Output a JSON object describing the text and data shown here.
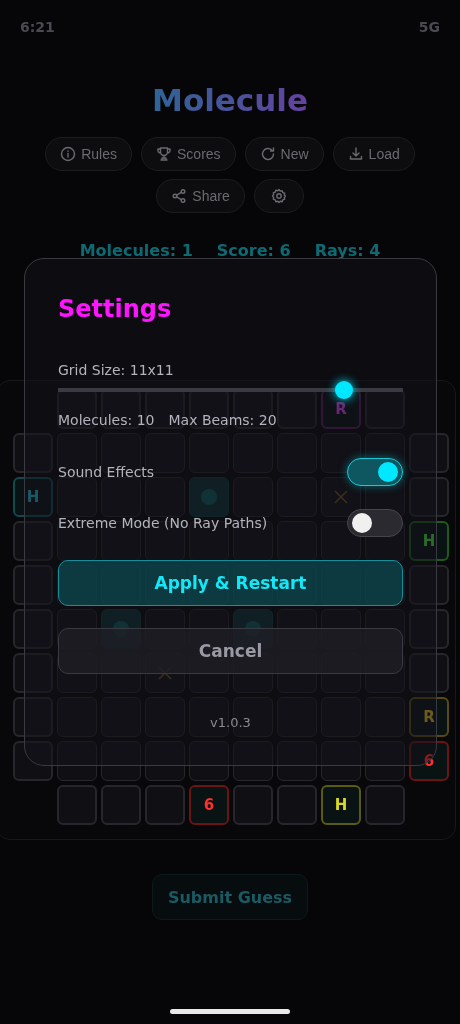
{
  "status_bar": {
    "time": "6:21",
    "network": "5G"
  },
  "title": "Molecule",
  "toolbar": [
    {
      "kind": "info",
      "label": "Rules"
    },
    {
      "kind": "trophy",
      "label": "Scores"
    },
    {
      "kind": "refresh",
      "label": "New"
    },
    {
      "kind": "download",
      "label": "Load"
    },
    {
      "kind": "share",
      "label": "Share"
    },
    {
      "kind": "settings"
    }
  ],
  "stats": [
    {
      "label": "Molecules:",
      "value": "1"
    },
    {
      "label": "Score:",
      "value": "6"
    },
    {
      "label": "Rays:",
      "value": "4"
    }
  ],
  "board": {
    "top": [
      {
        "kind": "plain"
      },
      {
        "kind": "plain"
      },
      {
        "kind": "plain"
      },
      {
        "kind": "plain"
      },
      {
        "kind": "plain"
      },
      {
        "kind": "plain"
      },
      {
        "kind": "marked",
        "color": "#5a1a5e",
        "text": "R"
      },
      {
        "kind": "plain"
      }
    ],
    "left": [
      {
        "kind": "plain"
      },
      {
        "kind": "marked",
        "color": "#0f4a50",
        "text": "H"
      },
      {
        "kind": "plain"
      },
      {
        "kind": "plain"
      },
      {
        "kind": "plain"
      },
      {
        "kind": "plain"
      },
      {
        "kind": "plain"
      },
      {
        "kind": "plain"
      }
    ],
    "right": [
      {
        "kind": "plain"
      },
      {
        "kind": "plain"
      },
      {
        "kind": "marked",
        "color": "#1f5a1a",
        "text": "H"
      },
      {
        "kind": "plain"
      },
      {
        "kind": "plain"
      },
      {
        "kind": "plain"
      },
      {
        "kind": "marked",
        "color": "#5a4a10",
        "text": "R"
      },
      {
        "kind": "marked",
        "color": "#6a1414",
        "text": "6"
      }
    ],
    "bottom": [
      {
        "kind": "plain"
      },
      {
        "kind": "plain"
      },
      {
        "kind": "plain"
      },
      {
        "kind": "marked",
        "color": "#6a1414",
        "text": "6"
      },
      {
        "kind": "plain"
      },
      {
        "kind": "plain"
      },
      {
        "kind": "marked",
        "color": "#5a5a10",
        "text": "H"
      },
      {
        "kind": "plain"
      }
    ],
    "rows": [
      [
        {
          "kind": "empty"
        },
        {
          "kind": "empty"
        },
        {
          "kind": "empty"
        },
        {
          "kind": "empty"
        },
        {
          "kind": "empty"
        },
        {
          "kind": "empty"
        },
        {
          "kind": "empty"
        },
        {
          "kind": "empty"
        }
      ],
      [
        {
          "kind": "empty"
        },
        {
          "kind": "empty"
        },
        {
          "kind": "empty"
        },
        {
          "kind": "dot"
        },
        {
          "kind": "empty"
        },
        {
          "kind": "empty"
        },
        {
          "kind": "cross"
        },
        {
          "kind": "empty"
        }
      ],
      [
        {
          "kind": "empty"
        },
        {
          "kind": "empty"
        },
        {
          "kind": "empty"
        },
        {
          "kind": "empty"
        },
        {
          "kind": "empty"
        },
        {
          "kind": "empty"
        },
        {
          "kind": "empty"
        },
        {
          "kind": "empty"
        }
      ],
      [
        {
          "kind": "empty"
        },
        {
          "kind": "empty"
        },
        {
          "kind": "empty"
        },
        {
          "kind": "empty"
        },
        {
          "kind": "empty"
        },
        {
          "kind": "empty"
        },
        {
          "kind": "empty"
        },
        {
          "kind": "empty"
        }
      ],
      [
        {
          "kind": "empty"
        },
        {
          "kind": "dot"
        },
        {
          "kind": "empty"
        },
        {
          "kind": "empty"
        },
        {
          "kind": "dot"
        },
        {
          "kind": "empty"
        },
        {
          "kind": "empty"
        },
        {
          "kind": "empty"
        }
      ],
      [
        {
          "kind": "empty"
        },
        {
          "kind": "empty"
        },
        {
          "kind": "cross"
        },
        {
          "kind": "empty"
        },
        {
          "kind": "empty"
        },
        {
          "kind": "empty"
        },
        {
          "kind": "empty"
        },
        {
          "kind": "empty"
        }
      ],
      [
        {
          "kind": "empty"
        },
        {
          "kind": "empty"
        },
        {
          "kind": "empty"
        },
        {
          "kind": "empty"
        },
        {
          "kind": "empty"
        },
        {
          "kind": "empty"
        },
        {
          "kind": "empty"
        },
        {
          "kind": "empty"
        }
      ],
      [
        {
          "kind": "empty"
        },
        {
          "kind": "empty"
        },
        {
          "kind": "empty"
        },
        {
          "kind": "empty"
        },
        {
          "kind": "empty"
        },
        {
          "kind": "empty"
        },
        {
          "kind": "empty"
        },
        {
          "kind": "empty"
        }
      ]
    ]
  },
  "submit_button": "Submit Guess",
  "settings": {
    "title": "Settings",
    "grid_size": "Grid Size: 11x11",
    "level": 0.83,
    "info": [
      "Molecules: 10",
      "Max Beams: 20"
    ],
    "toggles": [
      {
        "label": "Sound Effects",
        "on": true
      },
      {
        "label": "Extreme Mode (No Ray Paths)",
        "on": false
      }
    ],
    "buttons": [
      {
        "kind": "primary",
        "label": "Apply & Restart"
      },
      {
        "kind": "secondary",
        "label": "Cancel"
      }
    ],
    "version": "v1.0.3"
  }
}
